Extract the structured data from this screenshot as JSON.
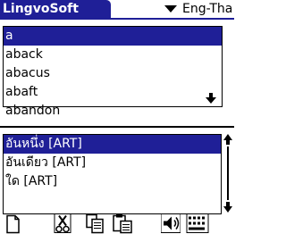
{
  "app": {
    "title": "LingvoSoft",
    "language_pair": "Eng-Tha"
  },
  "search": {
    "value": "a",
    "placeholder": ""
  },
  "word_list": {
    "items": [
      "a",
      "aback",
      "abacus",
      "abaft",
      "abandon"
    ],
    "selected_index": 0
  },
  "translations": {
    "items": [
      "อันหนึ่ง [ART]",
      "อันเดียว [ART]",
      "ใด [ART]"
    ],
    "selected_index": 0
  },
  "toolbar": {
    "buttons": [
      "new-document-icon",
      "cut-icon",
      "copy-icon",
      "paste-icon",
      "speaker-icon",
      "keyboard-icon"
    ]
  },
  "colors": {
    "accent": "#1f1f97",
    "background": "#ffffff",
    "text": "#000000"
  }
}
